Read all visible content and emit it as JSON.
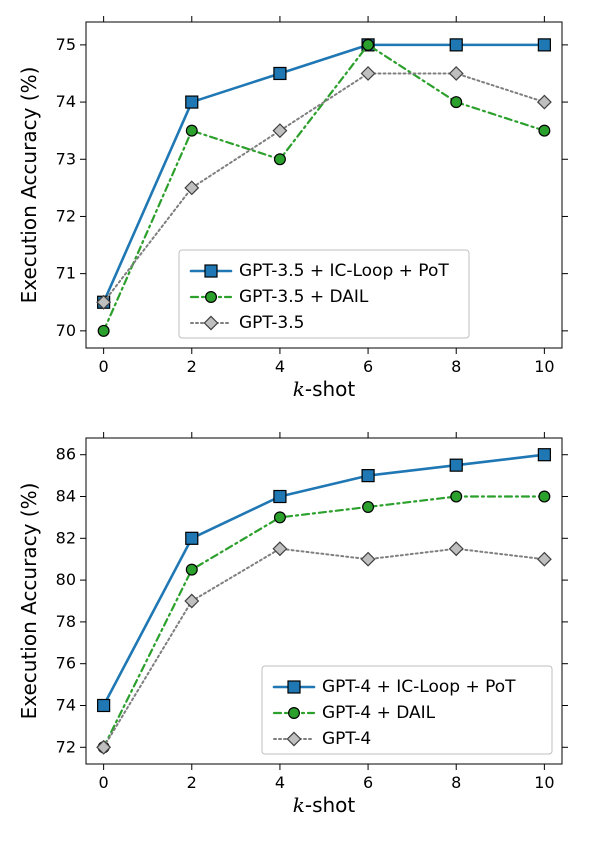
{
  "chart_data": [
    {
      "type": "line",
      "xlabel": "k-shot",
      "ylabel": "Execution Accuracy (%)",
      "x": [
        0,
        2,
        4,
        6,
        8,
        10
      ],
      "xlim": [
        -0.4,
        10.4
      ],
      "ylim": [
        69.7,
        75.4
      ],
      "yticks": [
        70,
        71,
        72,
        73,
        74,
        75
      ],
      "legend_position": "lower-center",
      "series": [
        {
          "name": "GPT-3.5 + IC-Loop + PoT",
          "style": "blue-square",
          "values": [
            70.5,
            74.0,
            74.5,
            75.0,
            75.0,
            75.0
          ]
        },
        {
          "name": "GPT-3.5 + DAIL",
          "style": "green-circle",
          "values": [
            70.0,
            73.5,
            73.0,
            75.0,
            74.0,
            73.5
          ]
        },
        {
          "name": "GPT-3.5",
          "style": "gray-diamond",
          "values": [
            70.5,
            72.5,
            73.5,
            74.5,
            74.5,
            74.0
          ]
        }
      ]
    },
    {
      "type": "line",
      "xlabel": "k-shot",
      "ylabel": "Execution Accuracy (%)",
      "x": [
        0,
        2,
        4,
        6,
        8,
        10
      ],
      "xlim": [
        -0.4,
        10.4
      ],
      "ylim": [
        71.2,
        86.8
      ],
      "yticks": [
        72,
        74,
        76,
        78,
        80,
        82,
        84,
        86
      ],
      "legend_position": "lower-right",
      "series": [
        {
          "name": "GPT-4 + IC-Loop + PoT",
          "style": "blue-square",
          "values": [
            74.0,
            82.0,
            84.0,
            85.0,
            85.5,
            86.0
          ]
        },
        {
          "name": "GPT-4 + DAIL",
          "style": "green-circle",
          "values": [
            72.0,
            80.5,
            83.0,
            83.5,
            84.0,
            84.0
          ]
        },
        {
          "name": "GPT-4",
          "style": "gray-diamond",
          "values": [
            72.0,
            79.0,
            81.5,
            81.0,
            81.5,
            81.0
          ]
        }
      ]
    }
  ]
}
